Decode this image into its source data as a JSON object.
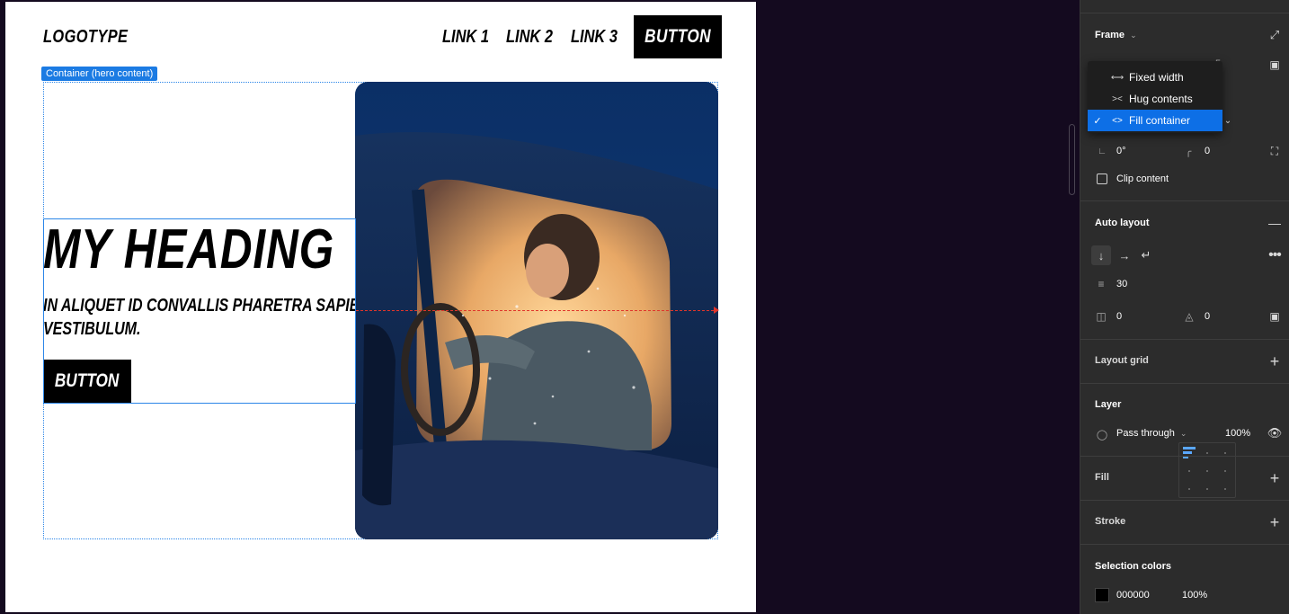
{
  "canvas": {
    "frame": {
      "logo": "LOGOTYPE",
      "nav_links": [
        "LINK 1",
        "LINK 2",
        "LINK 3"
      ],
      "nav_button": "BUTTON",
      "container_tag": "Container (hero content)",
      "heading": "MY HEADING",
      "paragraph": "IN ALIQUET ID CONVALLIS PHARETRA SAPIEN VITAE VESTIBULUM.",
      "hero_button": "BUTTON"
    }
  },
  "panel": {
    "frame_section": {
      "title": "Frame",
      "dropdown": {
        "items": [
          {
            "label": "Fixed width",
            "selected": false
          },
          {
            "label": "Hug contents",
            "selected": false
          },
          {
            "label": "Fill container",
            "selected": true
          }
        ],
        "peek_value": "5"
      },
      "rotation": "0°",
      "corner_radius": "0",
      "clip_content_label": "Clip content",
      "clip_content_checked": false
    },
    "auto_layout": {
      "title": "Auto layout",
      "gap": "30",
      "padding_horizontal": "0",
      "padding_vertical": "0"
    },
    "layout_grid": {
      "title": "Layout grid"
    },
    "layer": {
      "title": "Layer",
      "blend_mode": "Pass through",
      "opacity": "100%"
    },
    "fill": {
      "title": "Fill"
    },
    "stroke": {
      "title": "Stroke"
    },
    "selection_colors": {
      "title": "Selection colors",
      "hex": "000000",
      "opacity": "100%",
      "swatch": "#000000"
    }
  },
  "colors": {
    "canvas_bg": "#140a1f",
    "panel_bg": "#2c2c2c",
    "selection_blue": "#0d6fe6",
    "outline_blue": "#2b86e8",
    "measure_red": "#e0352b"
  }
}
